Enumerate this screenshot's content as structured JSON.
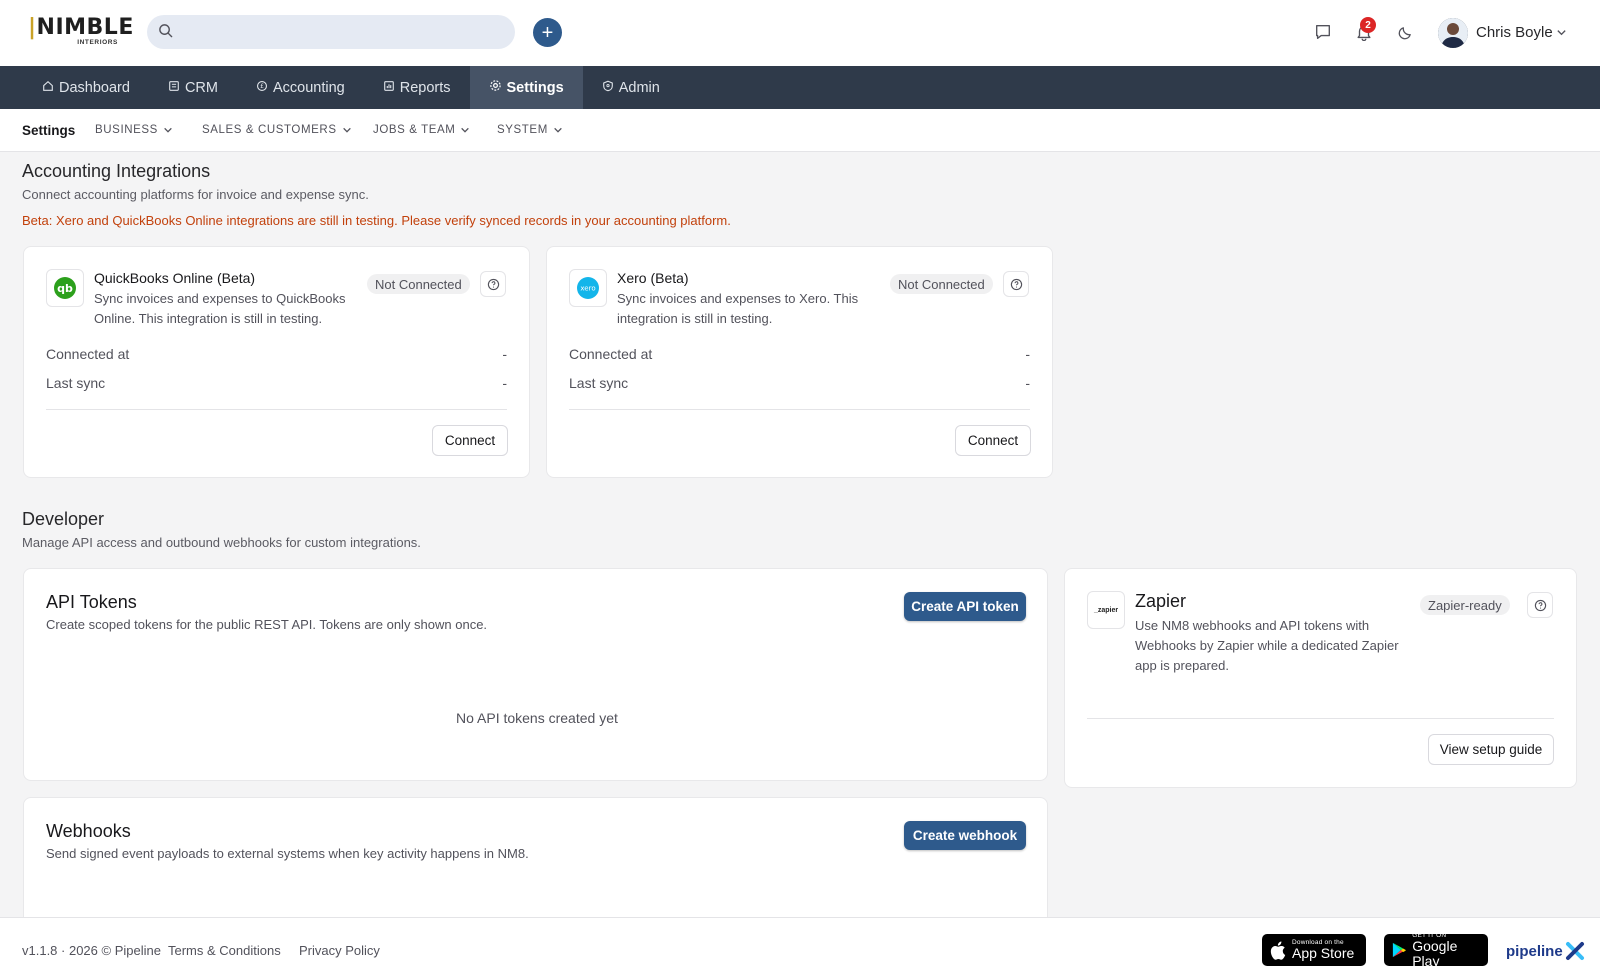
{
  "header": {
    "logo_text": "NIMBLE",
    "logo_sub": "INTERIORS",
    "search_placeholder": "",
    "add_label": "+",
    "notification_count": "2",
    "user_name": "Chris Boyle"
  },
  "main_nav": {
    "items": [
      {
        "label": "Dashboard",
        "icon": "home-icon"
      },
      {
        "label": "CRM",
        "icon": "book-icon"
      },
      {
        "label": "Accounting",
        "icon": "coin-icon"
      },
      {
        "label": "Reports",
        "icon": "report-icon"
      },
      {
        "label": "Settings",
        "icon": "gear-icon",
        "active": true
      },
      {
        "label": "Admin",
        "icon": "shield-icon"
      }
    ]
  },
  "sub_nav": {
    "current": "Settings",
    "items": [
      "BUSINESS",
      "SALES & CUSTOMERS",
      "JOBS & TEAM",
      "SYSTEM"
    ]
  },
  "accounting": {
    "title": "Accounting Integrations",
    "subtitle": "Connect accounting platforms for invoice and expense sync.",
    "beta_note": "Beta: Xero and QuickBooks Online integrations are still in testing. Please verify synced records in your accounting platform.",
    "cards": [
      {
        "name": "QuickBooks Online (Beta)",
        "description": "Sync invoices and expenses to QuickBooks Online. This integration is still in testing.",
        "status": "Not Connected",
        "connected_at_label": "Connected at",
        "connected_at_value": "-",
        "last_sync_label": "Last sync",
        "last_sync_value": "-",
        "button": "Connect"
      },
      {
        "name": "Xero (Beta)",
        "description": "Sync invoices and expenses to Xero. This integration is still in testing.",
        "status": "Not Connected",
        "connected_at_label": "Connected at",
        "connected_at_value": "-",
        "last_sync_label": "Last sync",
        "last_sync_value": "-",
        "button": "Connect"
      }
    ]
  },
  "developer": {
    "title": "Developer",
    "subtitle": "Manage API access and outbound webhooks for custom integrations.",
    "api_tokens": {
      "title": "API Tokens",
      "subtitle": "Create scoped tokens for the public REST API. Tokens are only shown once.",
      "button": "Create API token",
      "empty": "No API tokens created yet"
    },
    "webhooks": {
      "title": "Webhooks",
      "subtitle": "Send signed event payloads to external systems when key activity happens in NM8.",
      "button": "Create webhook"
    },
    "zapier": {
      "logo_text": "_zapier",
      "name": "Zapier",
      "description": "Use NM8 webhooks and API tokens with Webhooks by Zapier while a dedicated Zapier app is prepared.",
      "status": "Zapier-ready",
      "button": "View setup guide"
    }
  },
  "footer": {
    "version": "v1.1.8 · 2026 © Pipeline",
    "terms": "Terms & Conditions",
    "privacy": "Privacy Policy",
    "app_store_small": "Download on the",
    "app_store_big": "App Store",
    "google_play_small": "GET IT ON",
    "google_play_big": "Google Play",
    "brand": "pipeline"
  },
  "colors": {
    "primary": "#2e5a8c",
    "nav_bg": "#2f3a4a",
    "beta_text": "#c2410c",
    "badge": "#dc2626"
  }
}
